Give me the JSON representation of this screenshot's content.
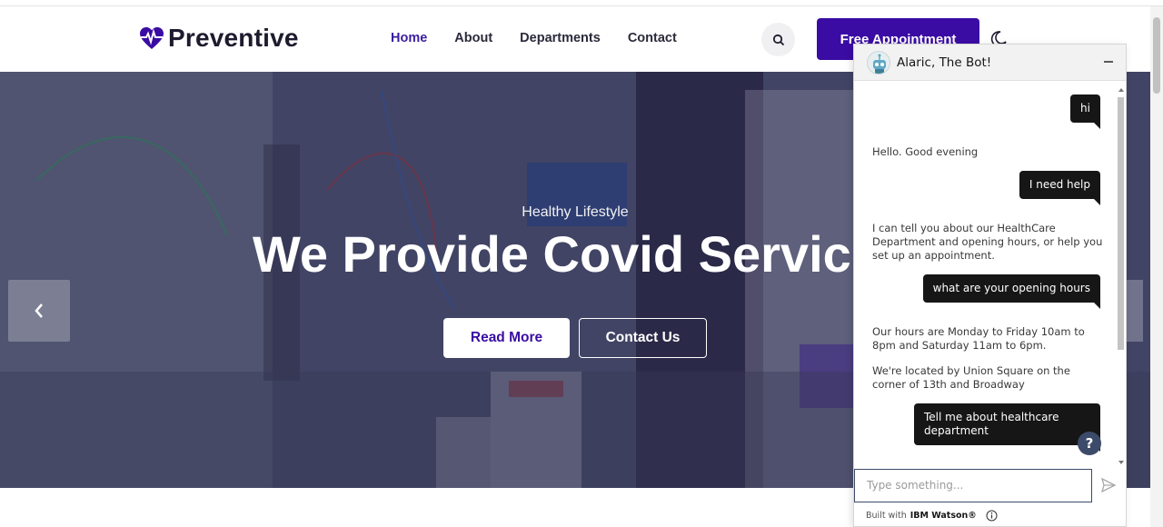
{
  "header": {
    "logo_text": "Preventive",
    "nav": [
      {
        "label": "Home",
        "active": true
      },
      {
        "label": "About"
      },
      {
        "label": "Departments"
      },
      {
        "label": "Contact"
      }
    ],
    "appointment_label": "Free Appointment",
    "icons": {
      "search": "search-icon",
      "theme": "moon-icon",
      "logo": "heart-pulse-icon"
    }
  },
  "hero": {
    "subtitle": "Healthy Lifestyle",
    "title": "We Provide Covid Service",
    "read_more": "Read More",
    "contact_us": "Contact Us",
    "prev_icon": "chevron-left-icon"
  },
  "chat": {
    "bot_name": "Alaric, The Bot!",
    "minimize_icon": "minimize-icon",
    "messages": [
      {
        "from": "user",
        "text": "hi"
      },
      {
        "from": "bot",
        "text": "Hello. Good evening"
      },
      {
        "from": "user",
        "text": "I need help"
      },
      {
        "from": "bot",
        "text": "I can tell you about our HealthCare Department and opening hours, or help you set up an appointment."
      },
      {
        "from": "user",
        "text": "what are your opening hours"
      },
      {
        "from": "bot",
        "text": "Our hours are Monday to Friday 10am to 8pm and Saturday 11am to 6pm."
      },
      {
        "from": "bot",
        "text": "We're located by Union Square on the corner of 13th and Broadway"
      },
      {
        "from": "user",
        "text": "Tell me about healthcare department"
      }
    ],
    "help_label": "?",
    "input_placeholder": "Type something...",
    "footer_prefix": "Built with",
    "footer_brand": "IBM Watson®"
  },
  "colors": {
    "accent": "#3a0ca3",
    "chat_dark": "#161616"
  }
}
